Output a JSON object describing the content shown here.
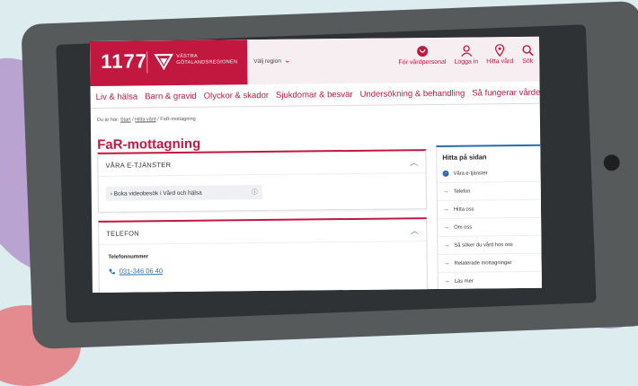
{
  "header": {
    "logo_number": "1177",
    "logo_region_line1": "VÄSTRA",
    "logo_region_line2": "GÖTALANDSREGIONEN",
    "region_select": "Välj region"
  },
  "tools": [
    {
      "label": "För vårdpersonal",
      "icon": "stethoscope-icon"
    },
    {
      "label": "Logga in",
      "icon": "user-icon"
    },
    {
      "label": "Hitta vård",
      "icon": "location-pin-icon"
    },
    {
      "label": "Sök",
      "icon": "search-icon"
    }
  ],
  "nav": [
    {
      "label": "Liv & hälsa"
    },
    {
      "label": "Barn & gravid"
    },
    {
      "label": "Olyckor & skador"
    },
    {
      "label": "Sjukdomar & besvär"
    },
    {
      "label": "Undersökning & behandling"
    },
    {
      "label": "Så fungerar vården"
    }
  ],
  "breadcrumb": {
    "prefix": "Du är här:",
    "start": "Start",
    "sep1": "/",
    "hitta": "Hitta vård",
    "sep2": "/",
    "current": "FaR-mottagning"
  },
  "page_title": "FaR-mottagning",
  "eservices": {
    "header": "VÅRA E-TJÄNSTER",
    "item": "Boka videobesök i Vård och hälsa"
  },
  "phone": {
    "header": "TELEFON",
    "label": "Telefonnummer",
    "number": "031-346 06 40"
  },
  "sidebar": {
    "title": "Hitta på sidan",
    "items": [
      {
        "label": "Våra e-tjänster"
      },
      {
        "label": "Telefon"
      },
      {
        "label": "Hitta oss"
      },
      {
        "label": "Om oss"
      },
      {
        "label": "Så söker du vård hos oss"
      },
      {
        "label": "Relaterade mottagningar"
      },
      {
        "label": "Läs mer"
      }
    ]
  },
  "colors": {
    "brand": "#c2183f",
    "link": "#2b6cb0",
    "background": "#dcecef",
    "hand": "#b8a3d1",
    "tablet_frame": "#575a5b"
  }
}
